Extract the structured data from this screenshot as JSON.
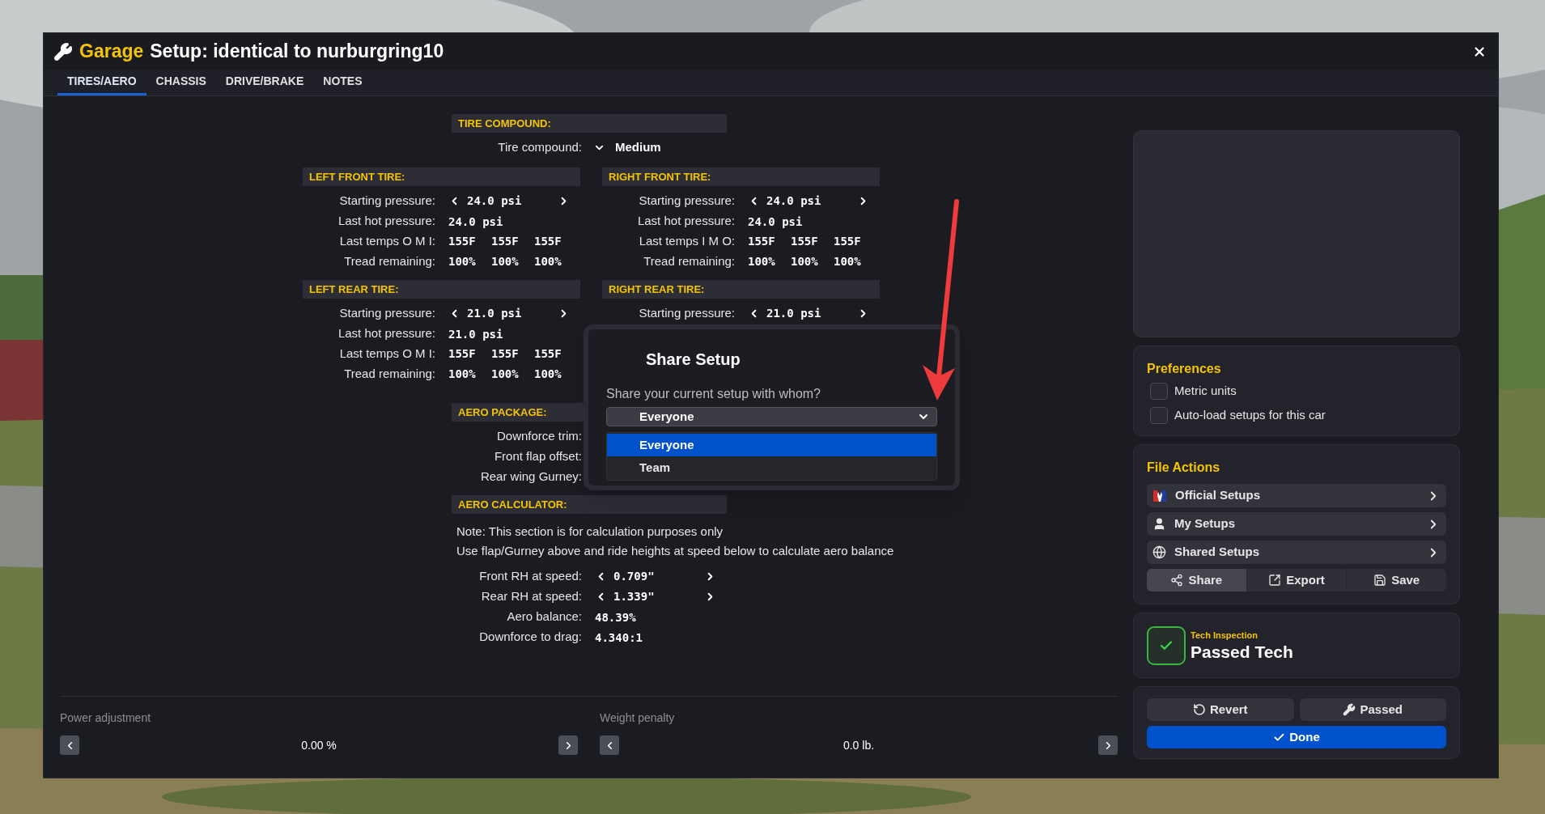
{
  "window": {
    "brand": "Garage",
    "title": "Setup: identical to nurburgring10"
  },
  "tabs": [
    {
      "label": "TIRES/AERO",
      "selected": true
    },
    {
      "label": "CHASSIS",
      "selected": false
    },
    {
      "label": "DRIVE/BRAKE",
      "selected": false
    },
    {
      "label": "NOTES",
      "selected": false
    }
  ],
  "tire_compound": {
    "header": "TIRE COMPOUND:",
    "label": "Tire compound:",
    "value": "Medium"
  },
  "tires": [
    {
      "header": "LEFT FRONT TIRE:",
      "rows": [
        {
          "kind": "stepper",
          "label": "Starting pressure:",
          "value": "24.0 psi"
        },
        {
          "kind": "value",
          "label": "Last hot pressure:",
          "value": "24.0 psi"
        },
        {
          "kind": "triple",
          "label": "Last temps O M I:",
          "values": [
            "155F",
            "155F",
            "155F"
          ]
        },
        {
          "kind": "triple",
          "label": "Tread remaining:",
          "values": [
            "100%",
            "100%",
            "100%"
          ]
        }
      ]
    },
    {
      "header": "RIGHT FRONT TIRE:",
      "rows": [
        {
          "kind": "stepper",
          "label": "Starting pressure:",
          "value": "24.0 psi"
        },
        {
          "kind": "value",
          "label": "Last hot pressure:",
          "value": "24.0 psi"
        },
        {
          "kind": "triple",
          "label": "Last temps I M O:",
          "values": [
            "155F",
            "155F",
            "155F"
          ]
        },
        {
          "kind": "triple",
          "label": "Tread remaining:",
          "values": [
            "100%",
            "100%",
            "100%"
          ]
        }
      ]
    },
    {
      "header": "LEFT REAR TIRE:",
      "rows": [
        {
          "kind": "stepper",
          "label": "Starting pressure:",
          "value": "21.0 psi"
        },
        {
          "kind": "value",
          "label": "Last hot pressure:",
          "value": "21.0 psi"
        },
        {
          "kind": "triple",
          "label": "Last temps O M I:",
          "values": [
            "155F",
            "155F",
            "155F"
          ]
        },
        {
          "kind": "triple",
          "label": "Tread remaining:",
          "values": [
            "100%",
            "100%",
            "100%"
          ]
        }
      ]
    },
    {
      "header": "RIGHT REAR TIRE:",
      "rows": [
        {
          "kind": "stepper",
          "label": "Starting pressure:",
          "value": "21.0 psi"
        }
      ]
    }
  ],
  "aero_package": {
    "header": "AERO PACKAGE:",
    "rows": [
      {
        "label": "Downforce trim:"
      },
      {
        "label": "Front flap offset:"
      },
      {
        "label": "Rear wing Gurney:"
      }
    ]
  },
  "aero_calculator": {
    "header": "AERO CALCULATOR:",
    "notes": [
      "Note: This section is for calculation purposes only",
      "Use flap/Gurney above and ride heights at speed below to calculate aero balance"
    ],
    "rows": [
      {
        "kind": "stepper",
        "label": "Front RH at speed:",
        "value": "0.709\""
      },
      {
        "kind": "stepper",
        "label": "Rear RH at speed:",
        "value": "1.339\""
      },
      {
        "kind": "value",
        "label": "Aero balance:",
        "value": "48.39%"
      },
      {
        "kind": "value",
        "label": "Downforce to drag:",
        "value": "4.340:1"
      }
    ]
  },
  "bottom_controls": [
    {
      "label": "Power adjustment",
      "value": "0.00 %"
    },
    {
      "label": "Weight penalty",
      "value": "0.0 lb."
    }
  ],
  "preferences": {
    "title": "Preferences",
    "options": [
      {
        "label": "Metric units",
        "checked": false
      },
      {
        "label": "Auto-load setups for this car",
        "checked": false
      }
    ]
  },
  "file_actions": {
    "title": "File Actions",
    "items": [
      {
        "label": "Official Setups"
      },
      {
        "label": "My Setups"
      },
      {
        "label": "Shared Setups"
      }
    ],
    "buttons": [
      {
        "label": "Share",
        "selected": true
      },
      {
        "label": "Export",
        "selected": false
      },
      {
        "label": "Save",
        "selected": false
      }
    ]
  },
  "tech_inspection": {
    "caption": "Tech Inspection",
    "status": "Passed Tech"
  },
  "actions": [
    {
      "label": "Revert"
    },
    {
      "label": "Passed"
    }
  ],
  "done": {
    "label": "Done"
  },
  "dialog": {
    "title": "Share Setup",
    "prompt": "Share your current setup with whom?",
    "select": {
      "value": "Everyone",
      "expanded": true
    },
    "options": [
      {
        "label": "Everyone",
        "selected": true
      },
      {
        "label": "Team",
        "selected": false
      }
    ]
  }
}
